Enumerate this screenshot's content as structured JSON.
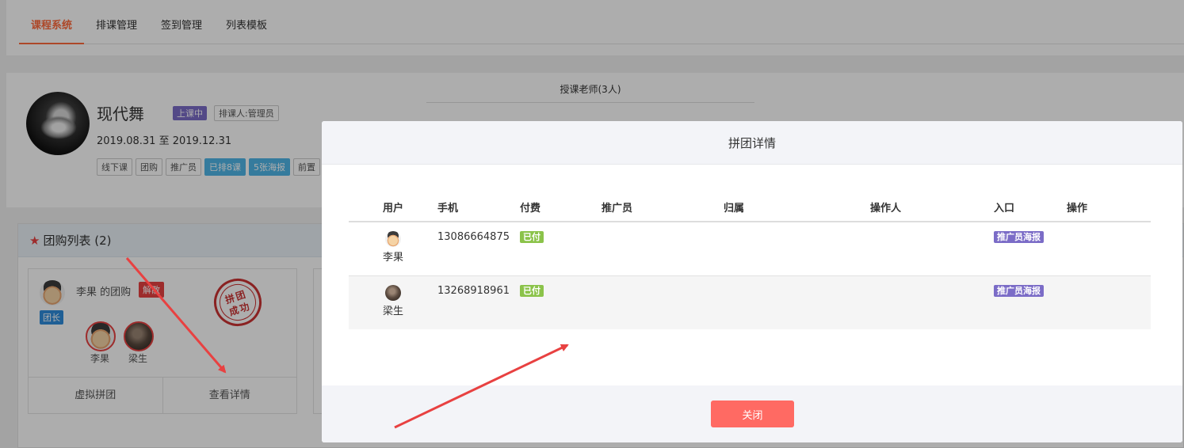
{
  "nav": {
    "tabs": [
      {
        "label": "课程系统",
        "active": true
      },
      {
        "label": "排课管理",
        "active": false
      },
      {
        "label": "签到管理",
        "active": false
      },
      {
        "label": "列表模板",
        "active": false
      }
    ]
  },
  "course": {
    "title": "现代舞",
    "status_badge": "上课中",
    "scheduler_badge": "排课人:管理员",
    "dates": "2019.08.31 至 2019.12.31",
    "tags": [
      "线下课",
      "团购",
      "推广员",
      "已排8课",
      "5张海报",
      "前置"
    ],
    "teachers_label": "授课老师(3人)"
  },
  "group_list": {
    "title": "团购列表 (2)",
    "card": {
      "group_name": "李果 的团购",
      "dissolve_badge": "解散",
      "leader_badge": "团长",
      "stamp_text": "拼团成功",
      "members": [
        "李果",
        "梁生"
      ],
      "virtual_button": "虚拟拼团",
      "detail_button": "查看详情"
    }
  },
  "modal": {
    "title": "拼团详情",
    "columns": [
      "用户",
      "手机",
      "付费",
      "推广员",
      "归属",
      "操作人",
      "入口",
      "操作"
    ],
    "rows": [
      {
        "user": "李果",
        "phone": "13086664875",
        "paid": "已付",
        "promoter": "",
        "belong": "",
        "operator": "",
        "entry": "推广员海报",
        "action": ""
      },
      {
        "user": "梁生",
        "phone": "13268918961",
        "paid": "已付",
        "promoter": "",
        "belong": "",
        "operator": "",
        "entry": "推广员海报",
        "action": ""
      }
    ],
    "close_label": "关闭"
  },
  "colors": {
    "accent": "#ff6a3d",
    "close_button": "#ff6a63",
    "paid_badge": "#8bc34a",
    "entry_badge": "#7b6cc7",
    "annotation_arrow": "#e84141"
  }
}
